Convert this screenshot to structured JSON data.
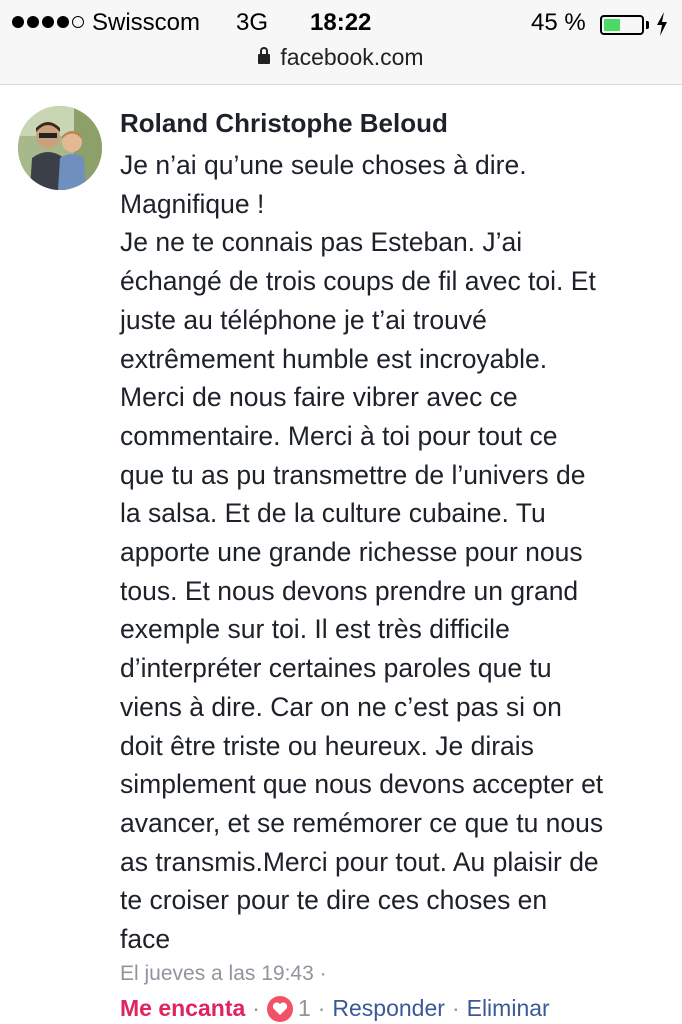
{
  "status_bar": {
    "carrier": "Swisscom",
    "network": "3G",
    "time": "18:22",
    "battery_percent": "45 %",
    "battery_level": 0.45,
    "signal_bars": 4,
    "signal_total": 5
  },
  "browser": {
    "url": "facebook.com"
  },
  "comment": {
    "author": "Roland Christophe Beloud",
    "text_lines": [
      "Je n’ai qu’une seule choses à dire.",
      "Magnifique !",
      "Je ne te connais pas Esteban. J’ai",
      "échangé de trois coups de fil avec toi. Et",
      "juste au téléphone je t’ai trouvé",
      "extrêmement humble est incroyable.",
      "Merci de nous faire vibrer avec ce",
      "commentaire. Merci à toi pour tout ce",
      "que tu as pu transmettre de l’univers de",
      "la salsa. Et de la culture cubaine. Tu",
      "apporte une grande richesse pour nous",
      "tous. Et nous devons prendre un grand",
      "exemple sur toi. Il est très difficile",
      "d’interpréter certaines paroles que tu",
      "viens à dire. Car on ne c’est pas si on",
      "doit être triste ou heureux. Je dirais",
      "simplement que nous devons accepter et",
      "avancer, et se remémorer ce que tu nous",
      "as transmis.Merci pour tout. Au plaisir de",
      "te croiser pour te dire ces choses en",
      "face"
    ],
    "timestamp": "El jueves a las 19:43 ·",
    "reaction_label": "Me encanta",
    "reaction_count": "1",
    "reply_label": "Responder",
    "delete_label": "Eliminar",
    "separator": "·"
  },
  "colors": {
    "accent": "#3b5998",
    "love": "#e0245e",
    "heart_badge": "#f25268",
    "muted": "#90949c",
    "battery": "#4cd964"
  },
  "icons": {
    "lock": "lock-icon",
    "battery": "battery-icon",
    "charging": "charging-bolt-icon",
    "heart": "heart-icon"
  }
}
